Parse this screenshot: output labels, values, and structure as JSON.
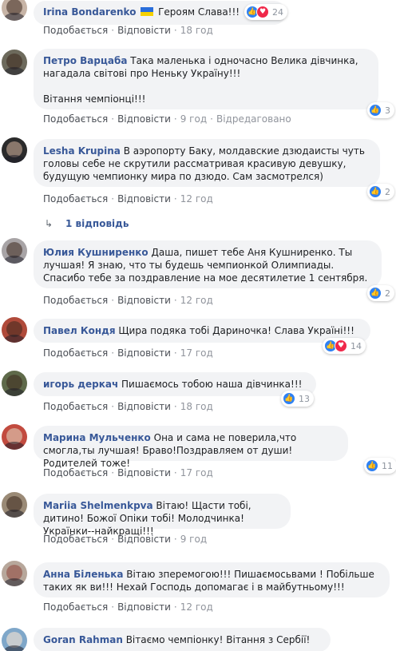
{
  "comments": [
    {
      "author": "Irina Bondarenko",
      "text_pre": "",
      "flag": "ukraine-flag",
      "text": "Героям Слава!!!",
      "reactions": {
        "types": [
          "like",
          "love"
        ],
        "count": "24"
      },
      "like": "Подобається",
      "reply": "Відповісти",
      "time": "18 год",
      "edited": ""
    },
    {
      "author": "Петро Варцаба",
      "text": "Така маленька і одночасно Велика дівчинка, нагадала світові про Неньку Україну!!!",
      "text2": "Вітання чемпіонці!!!",
      "reactions": {
        "types": [
          "like"
        ],
        "count": "3"
      },
      "like": "Подобається",
      "reply": "Відповісти",
      "time": "9 год",
      "edited": "Відредаговано"
    },
    {
      "author": "Lesha Krupina",
      "text": "В аэропорту Баку, молдавские дзюдаисты чуть головы себе не скрутили рассматривая красивую девушку, будущую чемпионку мира по дзюдо. Сам засмотрелся)",
      "reactions": {
        "types": [
          "like"
        ],
        "count": "2"
      },
      "like": "Подобається",
      "reply": "Відповісти",
      "time": "12 год"
    },
    {
      "author": "Юлия Кушниренко",
      "text": "Даша, пишет тебе Аня Кушниренко. Ты лучшая! Я знаю, что ты будешь чемпионкой Олимпиады. Спасибо тебе за поздравление на мое десятилетие 1 сентября.",
      "reactions": {
        "types": [
          "like"
        ],
        "count": "2"
      },
      "like": "Подобається",
      "reply": "Відповісти",
      "time": "12 год"
    },
    {
      "author": "Павел Кондя",
      "text": "Щира подяка тобі Дариночка! Слава Україні!!!",
      "reactions": {
        "types": [
          "like",
          "love"
        ],
        "count": "14"
      },
      "like": "Подобається",
      "reply": "Відповісти",
      "time": "17 год"
    },
    {
      "author": "игорь деркач",
      "text": "Пишаємось тобою наша дівчинка!!!",
      "reactions": {
        "types": [
          "like"
        ],
        "count": "13"
      },
      "like": "Подобається",
      "reply": "Відповісти",
      "time": "18 год"
    },
    {
      "author": "Марина Мульченко",
      "text": "Она и сама не поверила,что смогла,ты лучшая! Браво!Поздравляем от души!Родителей тоже!",
      "reactions": {
        "types": [
          "like"
        ],
        "count": "11"
      },
      "like": "Подобається",
      "reply": "Відповісти",
      "time": "17 год"
    },
    {
      "author": "Mariia Shelmenkpva",
      "text": "Вітаю! Щасти тобі, дитино! Божої Опіки тобі! Молодчинка! Українки--найкращі!!!",
      "like": "Подобається",
      "reply": "Відповісти",
      "time": "9 год"
    },
    {
      "author": "Анна Біленька",
      "text": "Вітаю зперемогою!!! Пишаємосьвами ! Побільше таких як ви!!! Нехай Господь допомагає і в майбутньому!!!",
      "like": "Подобається",
      "reply": "Відповісти",
      "time": "12 год"
    },
    {
      "author": "Goran Rahman",
      "text": "Вітаємо чемпіонку! Вітання з Сербії!"
    }
  ],
  "replies_link": "1 відповідь",
  "colors": {
    "author": "#385898",
    "bubble": "#f2f3f5",
    "like": "#2e81f4",
    "love": "#f0284a",
    "meta": "#90949c"
  }
}
